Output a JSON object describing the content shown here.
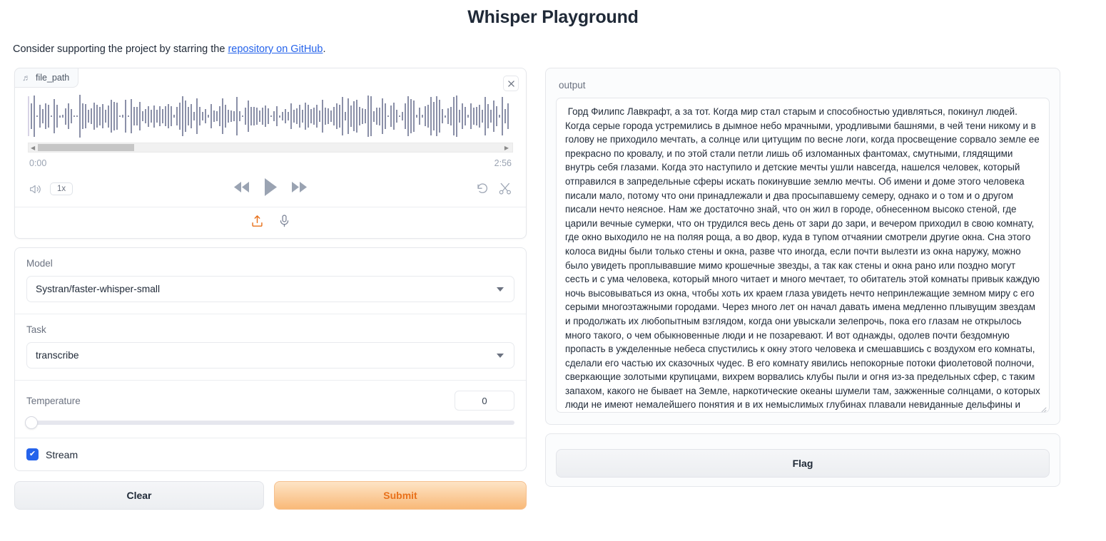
{
  "header": {
    "title": "Whisper Playground",
    "subtitle_before": "Consider supporting the project by starring the ",
    "subtitle_link": "repository on GitHub",
    "subtitle_after": "."
  },
  "audio": {
    "tab_label": "file_path",
    "note_icon": "music-note-icon",
    "close_icon": "×",
    "current_time": "0:00",
    "total_time": "2:56",
    "speed_label": "1x",
    "volume_icon": "volume-icon",
    "rewind_icon": "rewind-icon",
    "play_icon": "play-icon",
    "forward_icon": "fast-forward-icon",
    "undo_icon": "undo-icon",
    "trim_icon": "scissors-icon",
    "upload_icon": "upload-icon",
    "microphone_icon": "microphone-icon"
  },
  "settings": {
    "model_label": "Model",
    "model_value": "Systran/faster-whisper-small",
    "task_label": "Task",
    "task_value": "transcribe",
    "temperature_label": "Temperature",
    "temperature_value": "0",
    "stream_label": "Stream",
    "stream_checked": true,
    "check_glyph": "✔"
  },
  "actions": {
    "clear_label": "Clear",
    "submit_label": "Submit",
    "flag_label": "Flag"
  },
  "output": {
    "label": "output",
    "text": " Горд Филипс Лавкрафт, а за тот. Когда мир стал старым и способностью удивляться, покинул людей. Когда серые города устремились в дымное небо мрачными, уродливыми башнями, в чей тени никому и в голову не приходило мечтать, а солнце или цитущим по весне логи, когда просвещение сорвало земле ее прекрасно по кровалу, и по этой стали петли лишь об изломанных фантомах, смутными, глядящими внутрь себя глазами. Когда это наступило и детские мечты ушли навсегда, нашелся человек, который отправился в запредельные сферы искать покинувшие землю мечты. Об имени и доме этого человека писали мало, потому что они принадлежали и два просыпавшему семеру, однако и о том и о другом писали нечто неясное. Нам же достаточно знай, что он жил в городе, обнесенном высоко стеной, где царили вечные сумерки, что он трудился весь день от зари до зари, и вечером приходил в свою комнату, где окно выходило не на поляя роща, а во двор, куда в тупом отчаянии смотрели другие окна. Сна этого колоса видны были только стены и окна, разве что иногда, если почти вылезти из окна наружу, можно было увидеть проплывавшие мимо крошечные звезды, а так как стены и окна рано или поздно могут сесть и с ума человека, который много читает и много мечтает, то обитатель этой комнаты привык каждую ночь высовываться из окна, чтобы хоть их краем глаза увидеть нечто непринлежащие земном миру с его серыми многоэтажными городами. Через много лет он начал давать имена медленно плывущим звездам и продолжать их любопытным взглядом, когда они увыскали зелепрочь, пока его глазам не открылось много такого, о чем обыкновенные люди и не позаревают. И вот однажды, одолев почти бездомную пропасть в ужделенные небеса спустились к окну этого человека и смешавшись с воздухом его комнаты, сделали его частью их сказочных чудес. В его комнату явились непокорные потоки фиолетовой полночи, сверкающие золотыми крупицами, вихрем ворвались клубы пыли и огня из-за предельных сфер, с таким запахом, какого не бывает на Земле, наркотические океаны шумели там, зажженные солнцами, о которых люди не имеют немалейшего понятия и в их немыслимых глубинах плавали невиданные дельфины и морские"
  },
  "colors": {
    "accent_orange": "#e8701a",
    "link_blue": "#2563eb",
    "checkbox_blue": "#2563eb",
    "waveform": "#8b90a8"
  }
}
